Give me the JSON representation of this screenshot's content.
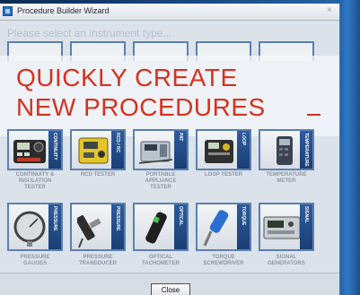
{
  "window": {
    "title": "Procedure Builder Wizard",
    "close_glyph": "×"
  },
  "prompt": "Please select an instrument type...",
  "headline": {
    "line1": "QUICKLY CREATE",
    "line2": "NEW PROCEDURES"
  },
  "row1": [
    {
      "band": "CONTINUITY",
      "caption": "CONTINUITY &\nINSULATION\nTESTER"
    },
    {
      "band": "RCD / RC",
      "caption": "RCD TESTER"
    },
    {
      "band": "PAT",
      "caption": "PORTABLE\nAPPLIANCE\nTESTER"
    },
    {
      "band": "LOOP",
      "caption": "LOOP TESTER"
    },
    {
      "band": "TEMPERATURE",
      "caption": "TEMPERATURE\nMETER"
    }
  ],
  "row2": [
    {
      "band": "PRESSURE GAUGES",
      "caption": "PRESSURE\nGAUGES"
    },
    {
      "band": "PRESSURE TRANSDUCER",
      "caption": "PRESSURE\nTRANSDUCER"
    },
    {
      "band": "OPTICAL TACHOMETER",
      "caption": "OPTICAL\nTACHOMETER"
    },
    {
      "band": "TORQUE SCREWDRIVER",
      "caption": "TORQUE\nSCREWDRIVER"
    },
    {
      "band": "SIGNAL GENERATORS",
      "caption": "SIGNAL\nGENERATORS"
    }
  ],
  "buttons": {
    "close": "Close"
  },
  "colors": {
    "accent": "#d6311f",
    "tile_border": "#5c7fb2",
    "band": "#1b3f74"
  }
}
